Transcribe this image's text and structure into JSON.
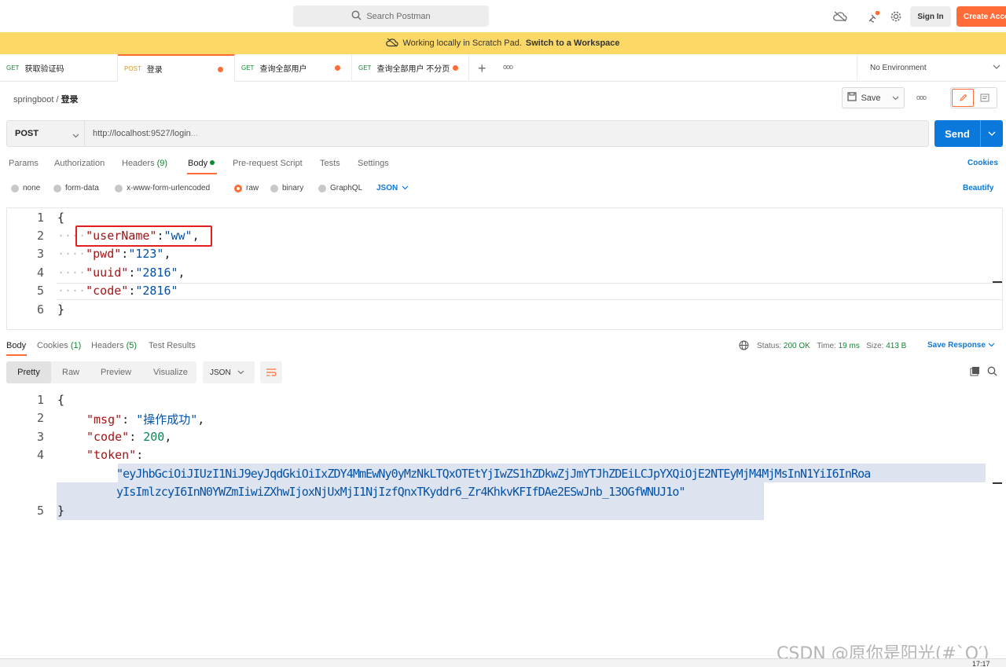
{
  "topbar": {
    "search_placeholder": "Search Postman",
    "sign_in": "Sign In",
    "create_account": "Create Account"
  },
  "banner": {
    "text": "Working locally in Scratch Pad.",
    "link": "Switch to a Workspace"
  },
  "tabs": [
    {
      "method": "GET",
      "label": "获取验证码",
      "method_color": "#0c8a30"
    },
    {
      "method": "POST",
      "label": "登录",
      "method_color": "#d49b2a"
    },
    {
      "method": "GET",
      "label": "查询全部用户",
      "method_color": "#0c8a30"
    },
    {
      "method": "GET",
      "label": "查询全部用户 不分页",
      "method_color": "#0c8a30"
    }
  ],
  "more_tabs_icon": "ooo",
  "environment": "No Environment",
  "breadcrumb": {
    "collection": "springboot",
    "separator": "/",
    "request": "登录"
  },
  "toolbar": {
    "save": "Save",
    "more": "ooo"
  },
  "request": {
    "method": "POST",
    "url": "http://localhost:9527/login",
    "send": "Send"
  },
  "request_tabs": {
    "params": "Params",
    "authorization": "Authorization",
    "headers": "Headers",
    "headers_count": "(9)",
    "body": "Body",
    "pre_request": "Pre-request Script",
    "tests": "Tests",
    "settings": "Settings",
    "cookies": "Cookies"
  },
  "body_types": {
    "none": "none",
    "form_data": "form-data",
    "urlencoded": "x-www-form-urlencoded",
    "raw": "raw",
    "binary": "binary",
    "graphql": "GraphQL",
    "format": "JSON",
    "beautify": "Beautify"
  },
  "request_body_lines": [
    {
      "num": "1",
      "text": "{"
    },
    {
      "num": "2",
      "key": "\"userName\"",
      "value": "\"ww\"",
      "trail": ","
    },
    {
      "num": "3",
      "key": "\"pwd\"",
      "value": "\"123\"",
      "trail": ","
    },
    {
      "num": "4",
      "key": "\"uuid\"",
      "value": "\"2816\"",
      "trail": ","
    },
    {
      "num": "5",
      "key": "\"code\"",
      "value": "\"2816\"",
      "trail": ""
    },
    {
      "num": "6",
      "text": "}"
    }
  ],
  "response_tabs": {
    "body": "Body",
    "cookies": "Cookies",
    "cookies_count": "(1)",
    "headers": "Headers",
    "headers_count": "(5)",
    "test_results": "Test Results"
  },
  "response_meta": {
    "status_label": "Status:",
    "status": "200 OK",
    "time_label": "Time:",
    "time": "19 ms",
    "size_label": "Size:",
    "size": "413 B",
    "save_response": "Save Response"
  },
  "response_view": {
    "pretty": "Pretty",
    "raw": "Raw",
    "preview": "Preview",
    "visualize": "Visualize",
    "format": "JSON"
  },
  "response_body": {
    "l1": "{",
    "msg_key": "\"msg\"",
    "msg_val": "\"操作成功\"",
    "code_key": "\"code\"",
    "code_val": "200",
    "token_key": "\"token\"",
    "token_line1": "\"eyJhbGciOiJIUzI1NiJ9eyJqdGkiOiIxZDY4MmEwNy0yMzNkLTQxOTEtYjIwZS1hZDkwZjJmYTJhZDEiLCJpYXQiOjE2NTEyMjM4MjMsInN1YiI6InRoa",
    "token_line2": "yIsImlzcyI6InN0YWZmIiwiZXhwIjoxNjUxMjI1NjIzfQnxTKyddr6_Zr4KhkvKFIfDAe2ESwJnb_13OGfWNUJ1o\"",
    "l5": "}"
  },
  "watermark": "CSDN @原你是阳光(#`O′)",
  "clock": "17:17"
}
